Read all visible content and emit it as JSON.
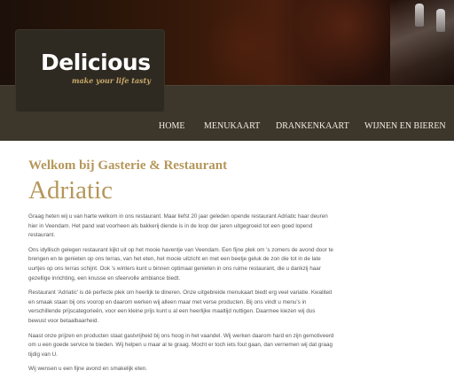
{
  "brand": {
    "name": "Delicious",
    "tagline": "make your life tasty",
    "accent_color": "#b5975a",
    "nav_background": "#3c362b"
  },
  "nav": {
    "items": [
      "HOME",
      "MENUKAART",
      "DRANKENKAART",
      "WIJNEN EN BIEREN"
    ]
  },
  "main": {
    "subtitle": "Welkom bij Gasterie & Restaurant",
    "title": "Adriatic",
    "paragraphs": [
      "Graag heten wij u van harte welkom in ons restaurant. Maar liefst 20 jaar geleden opende restaurant Adriatic haar deuren hier in Veendam. Het pand wat voorheen als bakkerij diende is in de loop der jaren uitgegroeid tot een goed lopend restaurant.",
      "Ons idyllisch gelegen restaurant kijkt uit op het mooie haventje van Veendam. Een fijne plek om 's zomers de avond door te brengen en te genieten op ons terras, van het eten, het mooie uitzicht en met een beetje geluk de zon die tot in de late uurtjes op ons terras schijnt. Ook 's winters kunt u binnen optimaal genieten in ons ruime restaurant, die u dankzij haar gezellige inrichting, een knusse en sfeervolle ambiance biedt.",
      "Restaurant 'Adriatic' is dé perfecte plek om heerlijk te dineren. Onze uitgebreide menukaart biedt erg veel variatie. Kwaliteit en smaak staan bij ons voorop en daarom werken wij alleen maar met verse producten. Bij ons vindt u menu's in verschillende prijscategorieën, voor een kleine prijs kunt u al een heerlijke maaltijd nuttigen. Daarmee kiezen wij dus bewust voor betaalbaarheid.",
      "Naast onze prijzen en producten staat gastvrijheid bij ons hoog in het vaandel. Wij werken daarom hard en zijn gemotiveerd om u een goede service te bieden. Wij helpen u maar al te graag. Mocht er toch iets fout gaan, dan vernemen wij dat graag tijdig van U.",
      "Wij wensen u een fijne avond en smakelijk eten."
    ]
  }
}
